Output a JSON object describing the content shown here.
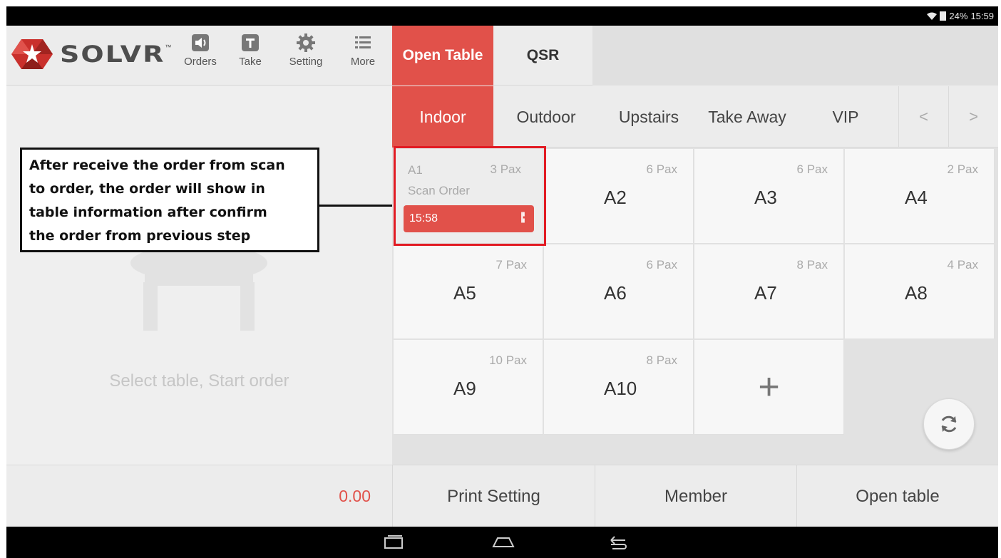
{
  "status_bar": {
    "battery": "24%",
    "time": "15:59"
  },
  "logo": {
    "text": "SOLVR",
    "tm": "™"
  },
  "toolbar": [
    {
      "label": "Orders",
      "icon": "speaker-icon"
    },
    {
      "label": "Take",
      "icon": "take-icon"
    },
    {
      "label": "Setting",
      "icon": "gear-icon"
    },
    {
      "label": "More",
      "icon": "list-icon"
    }
  ],
  "mode_tabs": [
    {
      "label": "Open Table",
      "active": true
    },
    {
      "label": "QSR",
      "active": false
    }
  ],
  "left_panel": {
    "hint": "Select table, Start order",
    "callout_lines": [
      "After receive the order from scan",
      "to order, the order will show in",
      "table information after confirm",
      "the order from previous step"
    ]
  },
  "area_tabs": [
    {
      "label": "Indoor",
      "active": true
    },
    {
      "label": "Outdoor",
      "active": false
    },
    {
      "label": "Upstairs",
      "active": false
    },
    {
      "label": "Take Away",
      "active": false
    },
    {
      "label": "VIP",
      "active": false
    }
  ],
  "nav_arrows": {
    "prev": "<",
    "next": ">"
  },
  "tables": [
    {
      "name": "A1",
      "pax": "3 Pax",
      "occupied": true,
      "source": "Scan Order",
      "time": "15:58"
    },
    {
      "name": "A2",
      "pax": "6 Pax"
    },
    {
      "name": "A3",
      "pax": "6 Pax"
    },
    {
      "name": "A4",
      "pax": "2 Pax"
    },
    {
      "name": "A5",
      "pax": "7 Pax"
    },
    {
      "name": "A6",
      "pax": "6 Pax"
    },
    {
      "name": "A7",
      "pax": "8 Pax"
    },
    {
      "name": "A8",
      "pax": "4 Pax"
    },
    {
      "name": "A9",
      "pax": "10 Pax"
    },
    {
      "name": "A10",
      "pax": "8 Pax"
    }
  ],
  "add_table_symbol": "+",
  "bottom_bar": {
    "total": "0.00",
    "actions": [
      "Print Setting",
      "Member",
      "Open table"
    ]
  },
  "colors": {
    "accent": "#e1514a",
    "highlight": "#e21b23"
  }
}
